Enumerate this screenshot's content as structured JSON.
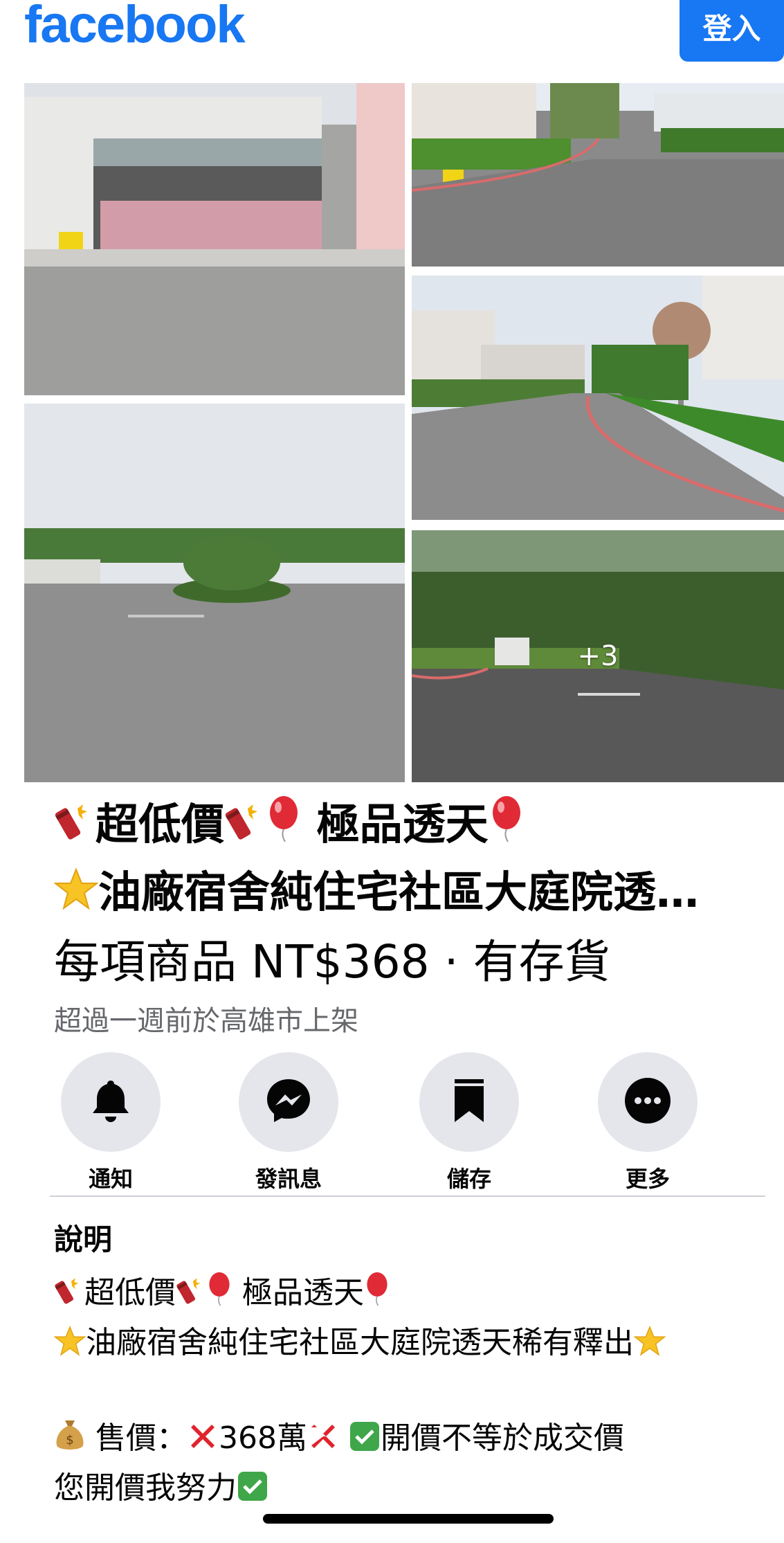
{
  "header": {
    "logo": "facebook",
    "login_label": "登入"
  },
  "gallery": {
    "more_count": "+3"
  },
  "listing": {
    "title_line1": "超低價",
    "title_line1b": "極品透天",
    "title_line2": "油廠宿舍純住宅社區大庭院透天稀有釋出",
    "price_line": "每項商品 NT$368 · 有存貨",
    "listed_info": "超過一週前於高雄市上架"
  },
  "actions": {
    "notify": "通知",
    "message": "發訊息",
    "save": "儲存",
    "more": "更多"
  },
  "description": {
    "heading": "說明",
    "line1a": "超低價",
    "line1b": "極品透天",
    "line2": "油廠宿舍純住宅社區大庭院透天稀有釋出",
    "line3a": "售價：",
    "line3b": "368萬",
    "line3c": "開價不等於成交價",
    "line4": "您開價我努力"
  },
  "colors": {
    "brand": "#1877f2",
    "secondary_text": "#65676b",
    "button_bg": "#e4e6eb"
  },
  "icons": [
    "firecracker-icon",
    "balloon-icon",
    "star-icon",
    "money-bag-icon",
    "cross-mark-icon",
    "check-mark-icon",
    "bell-icon",
    "messenger-icon",
    "bookmark-icon",
    "more-dots-icon"
  ]
}
